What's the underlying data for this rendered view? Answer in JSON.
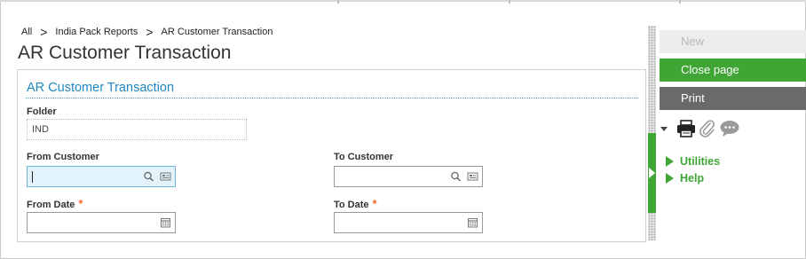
{
  "breadcrumb": {
    "items": [
      "All",
      "India Pack Reports",
      "AR Customer Transaction"
    ],
    "separator": ">"
  },
  "page": {
    "title": "AR Customer Transaction"
  },
  "section": {
    "title": "AR Customer Transaction"
  },
  "form": {
    "folder": {
      "label": "Folder",
      "value": "IND"
    },
    "from_customer": {
      "label": "From Customer",
      "value": ""
    },
    "to_customer": {
      "label": "To Customer",
      "value": ""
    },
    "from_date": {
      "label": "From Date",
      "required_mark": "*",
      "value": ""
    },
    "to_date": {
      "label": "To Date",
      "required_mark": "*",
      "value": ""
    }
  },
  "sidebar": {
    "new_label": "New",
    "close_label": "Close page",
    "print_label": "Print",
    "links": [
      "Utilities",
      "Help"
    ],
    "tool_icons": [
      "printer-icon",
      "paperclip-icon",
      "comment-icon"
    ]
  },
  "colors": {
    "accent_green": "#3fa535",
    "section_blue": "#1f88c2",
    "print_gray": "#6a6a6a",
    "required_orange": "#ef6a2a"
  }
}
